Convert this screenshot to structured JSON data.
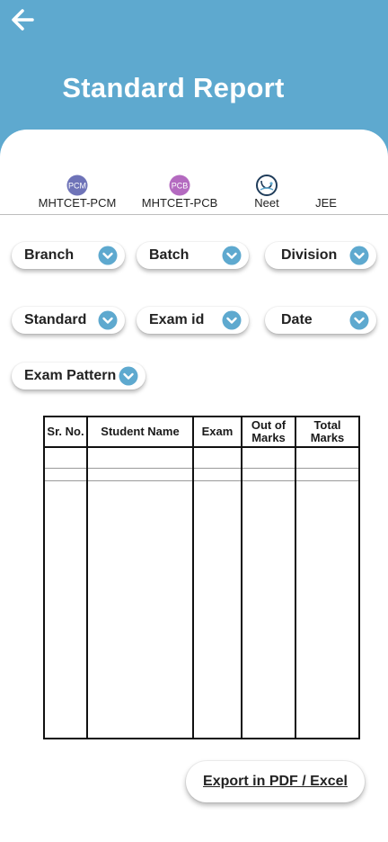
{
  "header": {
    "title": "Standard Report",
    "color": "#5ea9cf"
  },
  "tabs": [
    {
      "label": "MHTCET-PCM",
      "badge": "PCM",
      "color": "#6e73b8"
    },
    {
      "label": "MHTCET-PCB",
      "badge": "PCB",
      "color": "#b46ac0"
    },
    {
      "label": "Neet",
      "icon": "stethoscope-icon"
    },
    {
      "label": "JEE"
    }
  ],
  "filters": {
    "branch": "Branch",
    "batch": "Batch",
    "division": "Division",
    "standard": "Standard",
    "exam_id": "Exam id",
    "date": "Date",
    "exam_pattern": "Exam Pattern",
    "chevron_color": "#5ea9cf"
  },
  "table": {
    "columns": [
      "Sr. No.",
      "Student Name",
      "Exam",
      "Out of Marks",
      "Total Marks"
    ]
  },
  "export_label": "Export in PDF /  Excel"
}
